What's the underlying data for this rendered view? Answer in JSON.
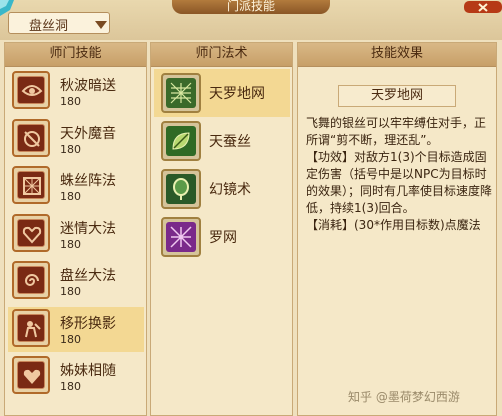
{
  "window": {
    "title": "门派技能"
  },
  "school_selector": {
    "value": "盘丝洞"
  },
  "skills_panel": {
    "header": "师门技能",
    "items": [
      {
        "name": "秋波暗送",
        "level": "180",
        "icon": "eye-wave-icon"
      },
      {
        "name": "天外魔音",
        "level": "180",
        "icon": "lute-icon"
      },
      {
        "name": "蛛丝阵法",
        "level": "180",
        "icon": "web-square-icon"
      },
      {
        "name": "迷情大法",
        "level": "180",
        "icon": "heart-swirl-icon"
      },
      {
        "name": "盘丝大法",
        "level": "180",
        "icon": "spiral-icon"
      },
      {
        "name": "移形换影",
        "level": "180",
        "icon": "shadow-figure-icon"
      },
      {
        "name": "姊妹相随",
        "level": "180",
        "icon": "heart-icon"
      }
    ],
    "selected_index": 5
  },
  "spells_panel": {
    "header": "师门法术",
    "items": [
      {
        "name": "天罗地网",
        "icon": "net-icon",
        "color": "#3a6a2a"
      },
      {
        "name": "天蚕丝",
        "icon": "silk-leaf-icon",
        "color": "#2f6a25"
      },
      {
        "name": "幻镜术",
        "icon": "mirror-icon",
        "color": "#2a5a28"
      },
      {
        "name": "罗网",
        "icon": "purple-net-icon",
        "color": "#7a2a8a"
      }
    ],
    "selected_index": 0
  },
  "effect_panel": {
    "header": "技能效果",
    "name": "天罗地网",
    "description": [
      "飞舞的银丝可以牢牢缚住对手，正所谓“剪不断，理还乱”。",
      "【功效】对敌方1(3)个目标造成固定伤害（括号中是以NPC为目标时的效果）；同时有几率使目标速度降低，持续1(3)回合。",
      "【消耗】(30*作用目标数)点魔法"
    ]
  },
  "watermark": "知乎 @墨荷梦幻西游"
}
